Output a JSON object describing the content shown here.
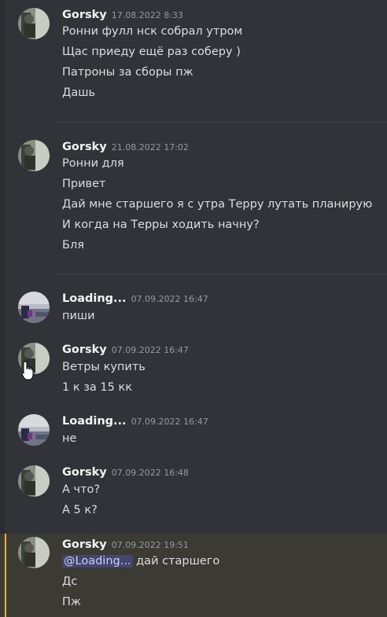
{
  "messages": [
    {
      "user": "Gorsky",
      "time": "17.08.2022 8:33",
      "avatar": "gorsky",
      "lines": [
        "Ронни фулл нск собрал утром",
        "Щас приеду ещё раз соберу )",
        "Патроны за сборы пж",
        "Дашь"
      ]
    },
    {
      "user": "Gorsky",
      "time": "21.08.2022 17:02",
      "avatar": "gorsky",
      "lines": [
        "Ронни для",
        "Привет",
        "Дай мне старшего я с утра Терру лутать планирую",
        "И когда на Терры ходить начну?",
        "Бля"
      ]
    },
    {
      "user": "Loading...",
      "time": "07.09.2022 16:47",
      "avatar": "loading",
      "lines": [
        "пиши"
      ]
    },
    {
      "user": "Gorsky",
      "time": "07.09.2022 16:47",
      "avatar": "gorsky",
      "lines": [
        "Ветры купить",
        "1 к за 15 кк"
      ]
    },
    {
      "user": "Loading...",
      "time": "07.09.2022 16:47",
      "avatar": "loading",
      "lines": [
        "не"
      ]
    },
    {
      "user": "Gorsky",
      "time": "07.09.2022 16:48",
      "avatar": "gorsky",
      "lines": [
        "А что?",
        "А 5 к?"
      ]
    },
    {
      "user": "Gorsky",
      "time": "07.09.2022 19:51",
      "avatar": "gorsky",
      "mention": "@Loading...",
      "first_line_rest": " дай старшего",
      "lines": [
        "Дс",
        "Пж"
      ]
    }
  ],
  "colors": {
    "background": "#313338",
    "highlight": "#3b3a33",
    "accent_bar": "#f0b232",
    "mention": "#c9cdfb"
  }
}
